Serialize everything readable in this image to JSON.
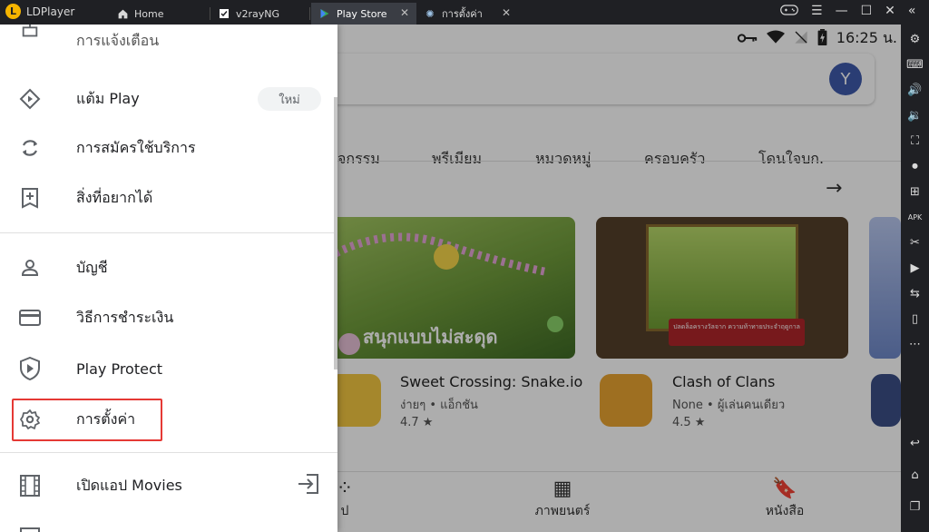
{
  "emulator": {
    "brand": "LDPlayer",
    "tabs": [
      {
        "label": "Home",
        "icon": "home-icon"
      },
      {
        "label": "v2rayNG",
        "icon": "v2rayng-icon"
      },
      {
        "label": "Play Store",
        "icon": "play-store-icon"
      },
      {
        "label": "การตั้งค่า",
        "icon": "settings-gear-icon"
      }
    ],
    "window_controls": [
      "gamepad-icon",
      "menu-icon",
      "minimize-icon",
      "maximize-icon",
      "collapse-icon"
    ]
  },
  "statusbar": {
    "time": "16:25 น."
  },
  "search": {
    "avatar_letter": "Y"
  },
  "categories": [
    "จกรรม",
    "พรีเมียม",
    "หมวดหมู่",
    "ครอบครัว",
    "โดนใจบก."
  ],
  "apps": [
    {
      "banner_text": "สนุกแบบไม่สะดุด",
      "title": "Sweet Crossing: Snake.io",
      "subtitle": "ง่ายๆ • แอ็กชัน",
      "rating": "4.7 ★"
    },
    {
      "banner_text": "ปลดล็อครางวัลจาก ความท้าทายประจำฤดูกาล",
      "title": "Clash of Clans",
      "subtitle": "None • ผู้เล่นคนเดียว",
      "rating": "4.5 ★"
    }
  ],
  "bottomnav": [
    {
      "label": "ป",
      "icon": "apps-grid-icon"
    },
    {
      "label": "ภาพยนตร์",
      "icon": "film-icon"
    },
    {
      "label": "หนังสือ",
      "icon": "book-icon"
    }
  ],
  "drawer": {
    "partial_top": "การแจ้งเตือน",
    "items": [
      {
        "label": "แต้ม Play",
        "icon": "play-points-icon",
        "badge": "ใหม่"
      },
      {
        "label": "การสมัครใช้บริการ",
        "icon": "subscriptions-refresh-icon"
      },
      {
        "label": "สิ่งที่อยากได้",
        "icon": "wishlist-icon"
      },
      {
        "label": "บัญชี",
        "icon": "account-person-icon"
      },
      {
        "label": "วิธีการชำระเงิน",
        "icon": "payment-card-icon"
      },
      {
        "label": "Play Protect",
        "icon": "play-protect-shield-icon"
      },
      {
        "label": "การตั้งค่า",
        "icon": "settings-gear-icon"
      },
      {
        "label": "เปิดแอป Movies",
        "icon": "movies-film-icon"
      }
    ]
  },
  "sidebar_icons": [
    "settings-icon",
    "keyboard-icon",
    "volume-up-icon",
    "volume-down-icon",
    "fullscreen-icon",
    "record-icon",
    "add-app-icon",
    "apk-icon",
    "scissors-icon",
    "video-icon",
    "sync-icon",
    "shake-icon",
    "more-icon",
    "back-icon",
    "home-icon",
    "recents-icon"
  ]
}
